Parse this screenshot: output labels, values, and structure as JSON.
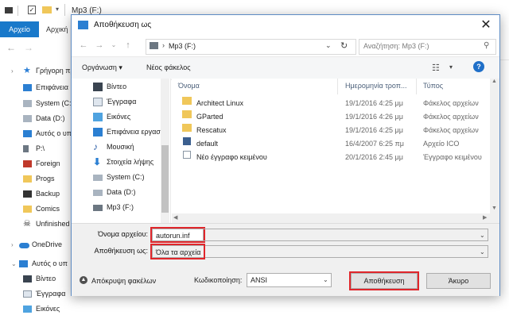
{
  "explorer": {
    "title": "Mp3 (F:)",
    "ribbon": {
      "file_tab": "Αρχείο",
      "home_tab": "Αρχική"
    },
    "sidebar": [
      {
        "label": "Γρήγορη πρ",
        "icon": "star-icon"
      },
      {
        "label": "Επιφάνεια",
        "icon": "desktop-icon"
      },
      {
        "label": "System (C:",
        "icon": "drive-icon"
      },
      {
        "label": "Data (D:)",
        "icon": "drive-icon"
      },
      {
        "label": "Αυτός ο υπ",
        "icon": "computer-icon"
      },
      {
        "label": "P:\\",
        "icon": "pin-icon"
      },
      {
        "label": "Foreign",
        "icon": "folder-icon"
      },
      {
        "label": "Progs",
        "icon": "folder-icon"
      },
      {
        "label": "Backup",
        "icon": "folder-icon"
      },
      {
        "label": "Comics",
        "icon": "folder-icon"
      },
      {
        "label": "Unfinished",
        "icon": "folder-icon"
      },
      {
        "label": "OneDrive",
        "icon": "cloud-icon"
      },
      {
        "label": "Αυτός ο υπ",
        "icon": "computer-icon"
      },
      {
        "label": "Βίντεο",
        "icon": "video-icon"
      },
      {
        "label": "Έγγραφα",
        "icon": "documents-icon"
      },
      {
        "label": "Εικόνες",
        "icon": "pictures-icon"
      }
    ]
  },
  "dialog": {
    "title": "Αποθήκευση ως",
    "close": "✕",
    "address": "Mp3 (F:)",
    "search_placeholder": "Αναζήτηση: Mp3 (F:)",
    "toolbar": {
      "organize": "Οργάνωση ▾",
      "new_folder": "Νέος φάκελος",
      "help": "?"
    },
    "nav": [
      {
        "label": "Βίντεο",
        "icon": "video-icon"
      },
      {
        "label": "Έγγραφα",
        "icon": "documents-icon"
      },
      {
        "label": "Εικόνες",
        "icon": "pictures-icon"
      },
      {
        "label": "Επιφάνεια εργασ",
        "icon": "desktop-icon"
      },
      {
        "label": "Μουσική",
        "icon": "music-icon"
      },
      {
        "label": "Στοιχεία λήψης",
        "icon": "downloads-icon"
      },
      {
        "label": "System (C:)",
        "icon": "drive-icon"
      },
      {
        "label": "Data (D:)",
        "icon": "drive-icon"
      },
      {
        "label": "Mp3 (F:)",
        "icon": "drive-icon"
      }
    ],
    "columns": {
      "name": "Όνομα",
      "date": "Ημερομηνία τροπ...",
      "type": "Τύπος"
    },
    "files": [
      {
        "name": "Architect Linux",
        "date": "19/1/2016 4:25 μμ",
        "type": "Φάκελος αρχείων",
        "icon": "folder-icon"
      },
      {
        "name": "GParted",
        "date": "19/1/2016 4:26 μμ",
        "type": "Φάκελος αρχείων",
        "icon": "folder-icon"
      },
      {
        "name": "Rescatux",
        "date": "19/1/2016 4:25 μμ",
        "type": "Φάκελος αρχείων",
        "icon": "folder-icon"
      },
      {
        "name": "default",
        "date": "16/4/2007 6:25 πμ",
        "type": "Αρχείο ICO",
        "icon": "ico-file-icon"
      },
      {
        "name": "Νέο έγγραφο κειμένου",
        "date": "20/1/2016 2:45 μμ",
        "type": "Έγγραφο κειμένου",
        "icon": "text-file-icon"
      }
    ],
    "form": {
      "filename_label": "Όνομα αρχείου:",
      "filename_value": "autorun.inf",
      "savetype_label": "Αποθήκευση ως:",
      "savetype_value": "Όλα τα αρχεία",
      "hide_folders": "Απόκρυψη φακέλων",
      "encoding_label": "Κωδικοποίηση:",
      "encoding_value": "ANSI",
      "save_button": "Αποθήκευση",
      "cancel_button": "Άκυρο"
    },
    "colors": {
      "highlight": "#e0262b",
      "accent": "#1979ca",
      "folder": "#f0c75a"
    }
  }
}
